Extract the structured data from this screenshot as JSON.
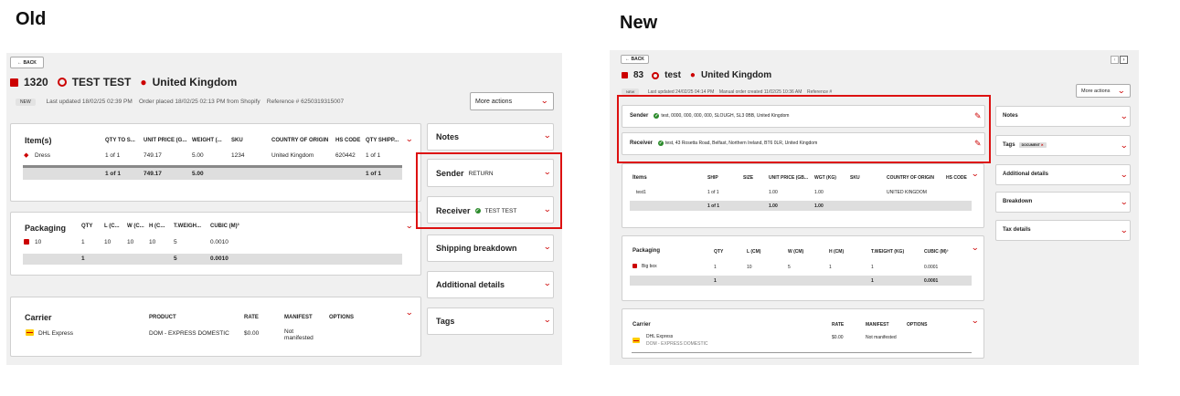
{
  "headings": {
    "old": "Old",
    "new": "New"
  },
  "old": {
    "back": "← BACK",
    "order_id": "1320",
    "customer": "TEST TEST",
    "destination": "United Kingdom",
    "status_badge": "NEW",
    "last_updated": "Last updated 18/02/25 02:39 PM",
    "order_placed": "Order placed 18/02/25 02:13 PM from Shopify",
    "reference": "Reference # 6250319315007",
    "more_actions": "More actions",
    "items": {
      "title": "Item(s)",
      "headers": [
        "QTY TO S...",
        "UNIT PRICE (G...",
        "WEIGHT (...",
        "SKU",
        "COUNTRY OF ORIGIN",
        "HS CODE",
        "QTY SHIPP..."
      ],
      "row": {
        "name": "Dress",
        "qty": "1 of 1",
        "price": "749.17",
        "weight": "5.00",
        "sku": "1234",
        "origin": "United Kingdom",
        "hs": "620442",
        "shipped": "1 of 1"
      },
      "totals": {
        "qty": "1 of 1",
        "price": "749.17",
        "weight": "5.00",
        "shipped": "1 of 1"
      }
    },
    "packaging": {
      "title": "Packaging",
      "headers": [
        "QTY",
        "L (C...",
        "W (C...",
        "H (C...",
        "T.WEIGH...",
        "CUBIC (M)³"
      ],
      "row": {
        "name": "10",
        "qty": "1",
        "l": "10",
        "w": "10",
        "h": "10",
        "weight": "5",
        "cubic": "0.0010"
      },
      "totals": {
        "qty": "1",
        "weight": "5",
        "cubic": "0.0010"
      }
    },
    "carrier": {
      "title": "Carrier",
      "headers": [
        "PRODUCT",
        "RATE",
        "MANIFEST",
        "OPTIONS"
      ],
      "row": {
        "name": "DHL Express",
        "product": "DOM - EXPRESS DOMESTIC",
        "rate": "$0.00",
        "manifest_line1": "Not",
        "manifest_line2": "manifested"
      }
    },
    "side": {
      "notes": "Notes",
      "sender": "Sender",
      "sender_value": "RETURN",
      "receiver": "Receiver",
      "receiver_value": "TEST TEST",
      "shipping_breakdown": "Shipping breakdown",
      "additional_details": "Additional details",
      "tags": "Tags"
    }
  },
  "new": {
    "back": "← BACK",
    "order_id": "83",
    "customer": "test",
    "destination": "United Kingdom",
    "status_badge": "NEW",
    "last_updated": "Last updated 24/02/25 04:14 PM",
    "order_created": "Manual order created 11/02/25 10:36 AM",
    "reference": "Reference #",
    "more_actions": "More actions",
    "sender_label": "Sender",
    "sender_value": "test, 0000, 000, 000, 000, SLOUGH, SL3 0BB, United Kingdom",
    "receiver_label": "Receiver",
    "receiver_value": "test, 43 Rosetta Road, Belfast, Northern Ireland, BT6 0LR, United Kingdom",
    "items": {
      "headers": [
        "Items",
        "SHIP",
        "SIZE",
        "UNIT PRICE (GB...",
        "WGT (KG)",
        "SKU",
        "COUNTRY OF ORIGIN",
        "HS CODE"
      ],
      "row": {
        "name": "test1",
        "ship": "1 of 1",
        "price": "1.00",
        "weight": "1.00",
        "origin": "UNITED KINGDOM"
      },
      "totals": {
        "ship": "1 of 1",
        "price": "1.00",
        "weight": "1.00"
      }
    },
    "packaging": {
      "title": "Packaging",
      "headers": [
        "QTY",
        "L (CM)",
        "W (CM)",
        "H (CM)",
        "T.WEIGHT (KG)",
        "CUBIC (M)³"
      ],
      "row": {
        "name": "Big box",
        "qty": "1",
        "l": "10",
        "w": "5",
        "h": "1",
        "weight": "1",
        "cubic": "0.0001"
      },
      "totals": {
        "qty": "1",
        "weight": "1",
        "cubic": "0.0001"
      }
    },
    "carrier": {
      "title": "Carrier",
      "headers": [
        "RATE",
        "MANIFEST",
        "OPTIONS"
      ],
      "row": {
        "name": "DHL Express",
        "product": "DOM - EXPRESS DOMESTIC",
        "rate": "$0.00",
        "manifest": "Not manifested"
      }
    },
    "side": {
      "notes": "Notes",
      "tags": "Tags",
      "tag_chip": "DOCUMENT",
      "additional_details": "Additional details",
      "breakdown": "Breakdown",
      "tax_details": "Tax details"
    }
  }
}
